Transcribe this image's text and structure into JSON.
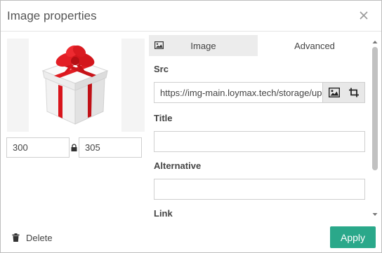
{
  "dialog": {
    "title": "Image properties"
  },
  "preview": {
    "width": "300",
    "height": "305"
  },
  "tabs": [
    {
      "label": "Image",
      "active": true
    },
    {
      "label": "Advanced",
      "active": false
    }
  ],
  "fields": {
    "src_label": "Src",
    "src_value": "https://img-main.loymax.tech/storage/up",
    "title_label": "Title",
    "title_value": "",
    "alt_label": "Alternative",
    "alt_value": "",
    "link_label": "Link"
  },
  "footer": {
    "delete_label": "Delete",
    "apply_label": "Apply"
  },
  "colors": {
    "accent": "#2aa88a",
    "gift_ribbon": "#d8151c"
  }
}
